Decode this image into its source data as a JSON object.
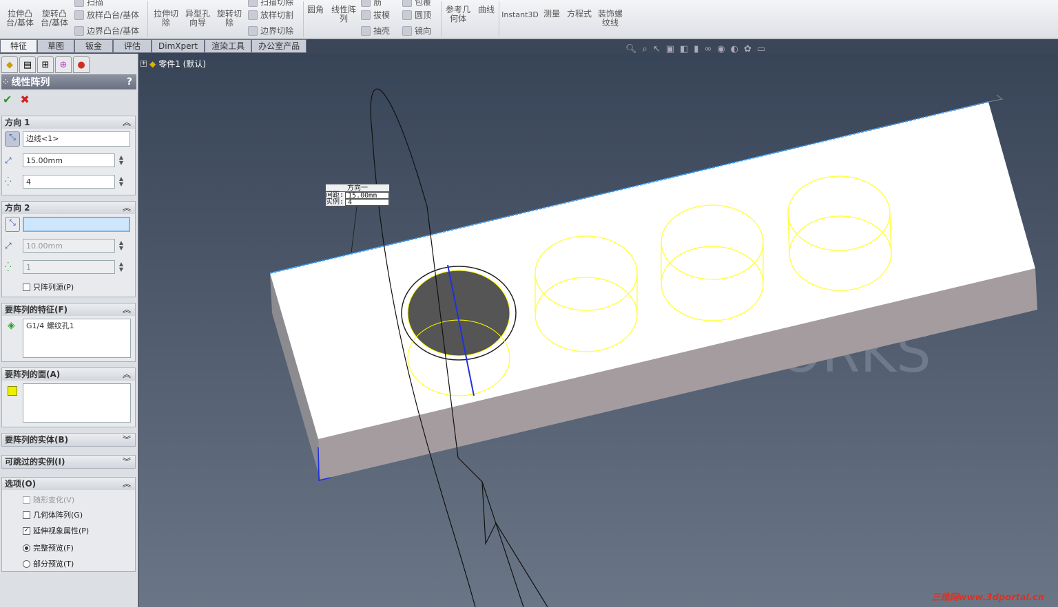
{
  "ribbon": {
    "large": [
      "拉伸凸\n台/基体",
      "旋转凸\n台/基体",
      "拉伸切\n除",
      "异型孔\n向导",
      "旋转切\n除",
      "圆角",
      "线性阵\n列",
      "参考几\n何体",
      "曲线",
      "Instant3D",
      "测量",
      "方程式",
      "装饰螺\n纹线"
    ],
    "small": [
      "扫描",
      "放样凸台/基体",
      "边界凸台/基体",
      "扫描切除",
      "放样切割",
      "边界切除",
      "筋",
      "拔模",
      "抽壳",
      "包覆",
      "圆顶",
      "镜向"
    ]
  },
  "tabs": [
    "特征",
    "草图",
    "钣金",
    "评估",
    "DimXpert",
    "渲染工具",
    "办公室产品"
  ],
  "tree": {
    "root": "零件1  (默认)"
  },
  "panel": {
    "title": "线性阵列",
    "help": "?",
    "dir1": {
      "header": "方向 1",
      "edge": "边线<1>",
      "spacing": "15.00mm",
      "count": "4"
    },
    "dir2": {
      "header": "方向 2",
      "edge": "",
      "spacing": "10.00mm",
      "count": "1",
      "only_seed": "只阵列源(P)",
      "only_seed_checked": false
    },
    "features": {
      "header": "要阵列的特征(F)",
      "value": "G1/4 螺纹孔1"
    },
    "faces": {
      "header": "要阵列的面(A)"
    },
    "bodies": {
      "header": "要阵列的实体(B)"
    },
    "skip": {
      "header": "可跳过的实例(I)"
    },
    "options": {
      "header": "选项(O)",
      "items": [
        {
          "label": "随形变化(V)",
          "checked": false,
          "disabled": true
        },
        {
          "label": "几何体阵列(G)",
          "checked": false
        },
        {
          "label": "延伸视象属性(P)",
          "checked": true
        }
      ],
      "radios": [
        {
          "label": "完整预览(F)",
          "selected": true
        },
        {
          "label": "部分预览(T)",
          "selected": false
        }
      ]
    }
  },
  "callout": {
    "title": "方向一",
    "spacing_label": "间距:",
    "spacing": "15.00mm",
    "count_label": "实例:",
    "count": "4"
  },
  "watermark": "三维网www.3dportal.cn",
  "colors": {
    "preview": "#ffff33",
    "edge_highlight": "#3aa0ff",
    "viewport_top": "#384457",
    "viewport_bottom": "#6a7686"
  }
}
